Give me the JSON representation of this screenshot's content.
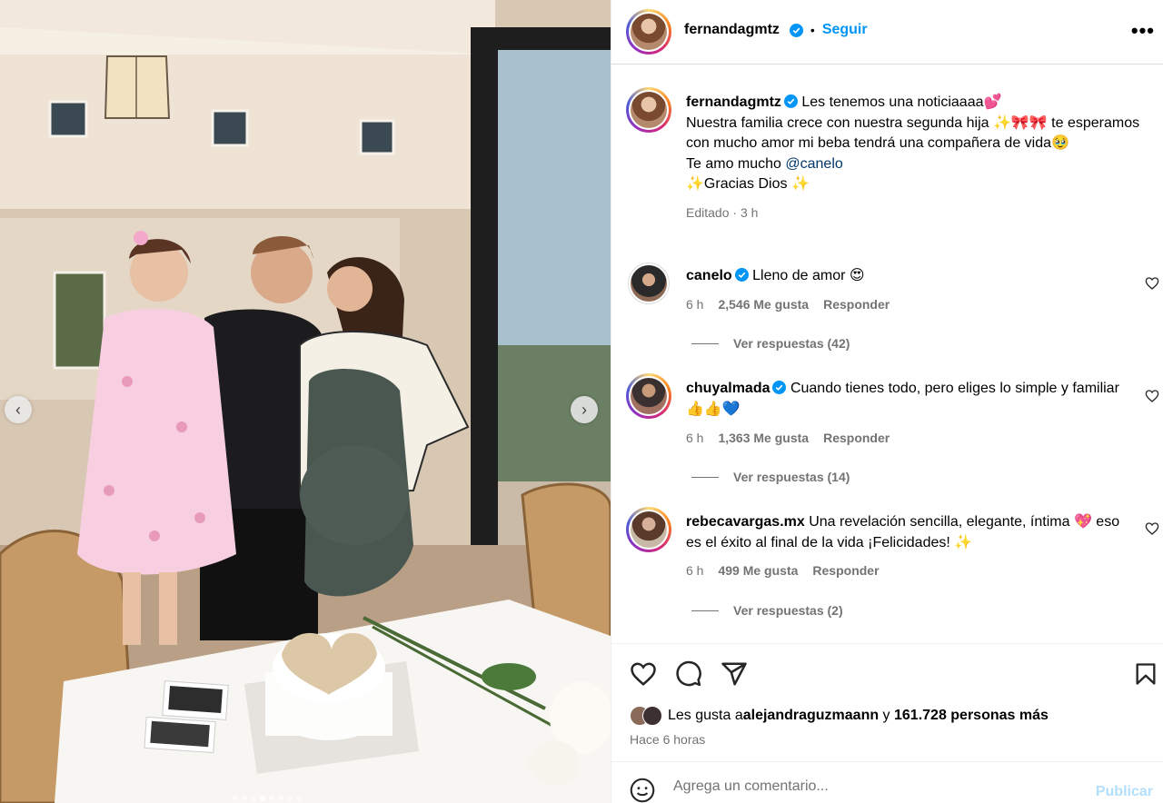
{
  "post": {
    "author": "fernandagmtz",
    "follow_label": "Seguir",
    "separator": "•",
    "more_label": "•••",
    "caption": {
      "line1": "Les tenemos una noticiaaaa💕",
      "line2": "Nuestra familia crece con nuestra segunda hija ✨🎀🎀 te esperamos con mucho amor mi beba tendrá una compañera de vida🥹",
      "line3_prefix": "Te amo mucho ",
      "mention": "@canelo",
      "line4": "✨Gracias Dios ✨"
    },
    "edited_label": "Editado",
    "edited_time": "3 h",
    "meta_sep": "·"
  },
  "media": {
    "prev_icon": "chevron-left-icon",
    "next_icon": "chevron-right-icon",
    "prev_glyph": "‹",
    "next_glyph": "›"
  },
  "comments": [
    {
      "user": "canelo",
      "text": "Lleno de amor 😍",
      "time": "6 h",
      "likes": "2,546 Me gusta",
      "reply": "Responder",
      "view_replies": "Ver respuestas (42)"
    },
    {
      "user": "chuyalmada",
      "text": "Cuando tienes todo, pero eliges lo simple y familiar 👍👍💙",
      "time": "6 h",
      "likes": "1,363 Me gusta",
      "reply": "Responder",
      "view_replies": "Ver respuestas (14)"
    },
    {
      "user": "rebecavargas.mx",
      "text": "Una revelación sencilla, elegante, íntima 💖 eso es el éxito al final de la vida ¡Felicidades! ✨",
      "time": "6 h",
      "likes": "499 Me gusta",
      "reply": "Responder",
      "view_replies": "Ver respuestas (2)"
    }
  ],
  "likes": {
    "prefix": "Les gusta a ",
    "user": "alejandraguzmaann",
    "connector": " y ",
    "others": "161.728 personas más"
  },
  "time_ago": "Hace 6 horas",
  "comment_input": {
    "placeholder": "Agrega un comentario...",
    "publish_label": "Publicar"
  },
  "colors": {
    "link_blue": "#0095f6",
    "publish_disabled": "#b2dffc",
    "secondary_text": "#737373",
    "verified": "#0095f6"
  },
  "icons": [
    "verified-icon",
    "more-icon",
    "heart-icon",
    "comment-icon",
    "share-icon",
    "bookmark-icon",
    "emoji-icon"
  ]
}
